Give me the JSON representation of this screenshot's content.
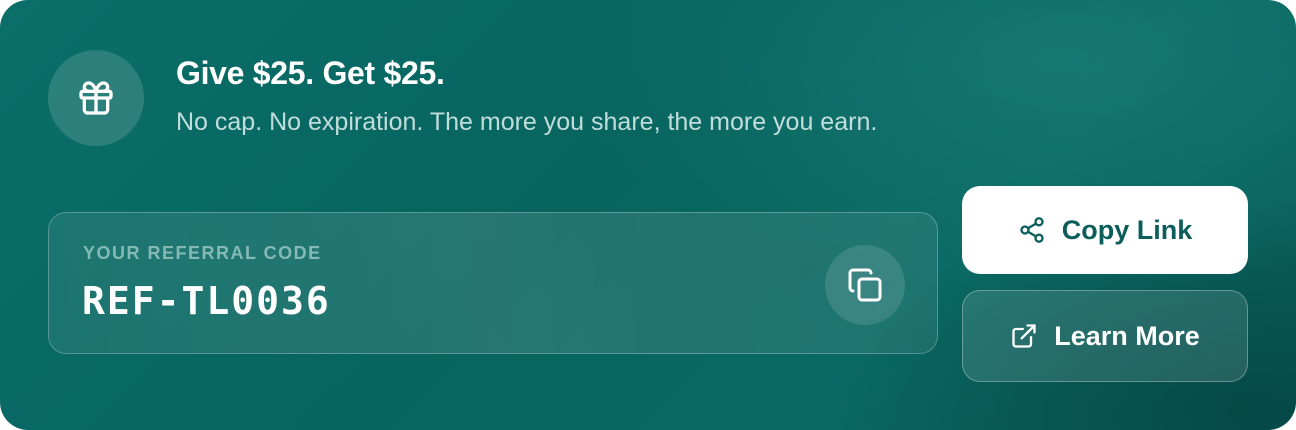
{
  "referral": {
    "title": "Give $25. Get $25.",
    "subtitle": "No cap. No expiration. The more you share, the more you earn.",
    "gift_icon": "gift-icon",
    "code_label": "YOUR REFERRAL CODE",
    "code_value": "REF-TL0036",
    "copy_code_icon": "copy-icon"
  },
  "actions": {
    "copy_link_label": "Copy Link",
    "copy_link_icon": "share-icon",
    "learn_more_label": "Learn More",
    "learn_more_icon": "external-link-icon"
  },
  "colors": {
    "card_background": "#07645f",
    "primary_button_text": "#0b5e5a",
    "white": "#ffffff"
  }
}
